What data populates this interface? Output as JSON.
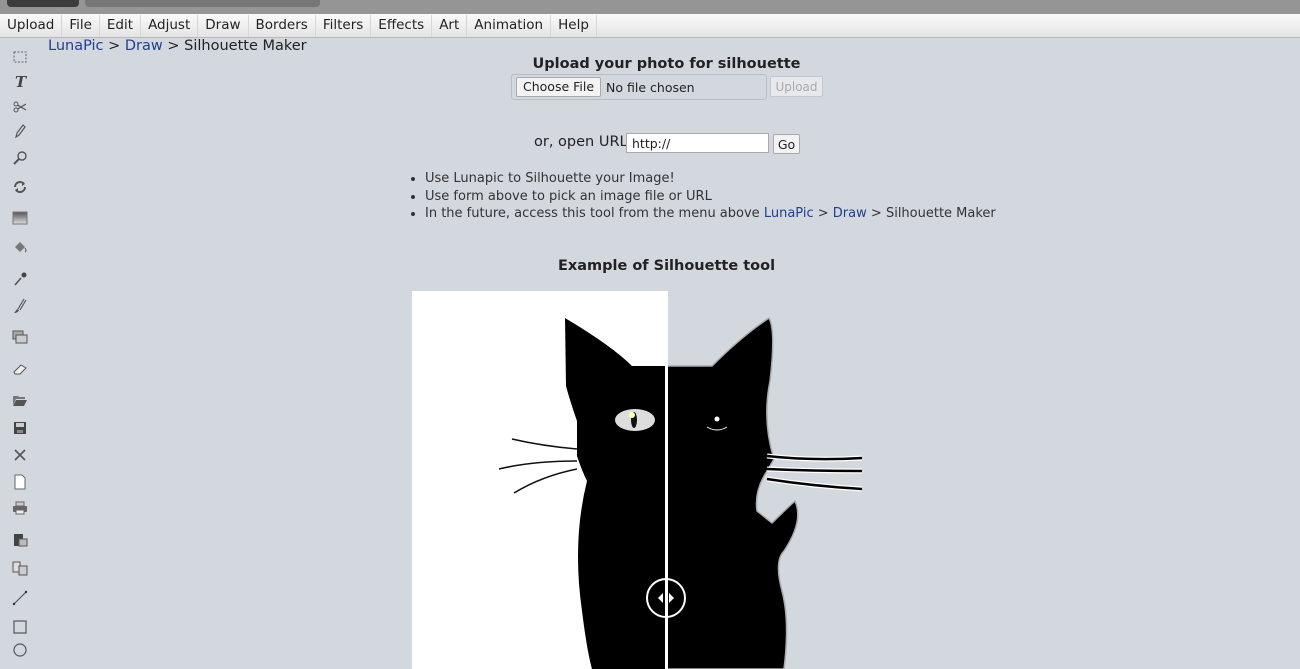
{
  "menu": {
    "items": [
      "Upload",
      "File",
      "Edit",
      "Adjust",
      "Draw",
      "Borders",
      "Filters",
      "Effects",
      "Art",
      "Animation",
      "Help"
    ]
  },
  "toolbar": {
    "tools": [
      "select-icon",
      "text-icon",
      "scissors-icon",
      "pencil-icon",
      "zoom-icon",
      "rotate-icon",
      "gradient-icon",
      "paint-bucket-icon",
      "eyedropper-icon",
      "brush-icon",
      "layers-icon",
      "eraser-icon",
      "open-folder-icon",
      "save-icon",
      "close-icon",
      "new-page-icon",
      "print-icon",
      "paste-icon",
      "copy-icon",
      "line-icon",
      "rectangle-icon",
      "circle-icon"
    ]
  },
  "breadcrumb": {
    "root": "LunaPic",
    "sep1": ">",
    "section": "Draw",
    "sep2": ">",
    "current": "Silhouette Maker"
  },
  "upload": {
    "title": "Upload your photo for silhouette",
    "choose_label": "Choose File",
    "file_status": "No file chosen",
    "upload_label": "Upload"
  },
  "url": {
    "label": "or, open URL",
    "value": "http://",
    "go_label": "Go"
  },
  "tips": {
    "item1": "Use Lunapic to Silhouette your Image!",
    "item2": "Use form above to pick an image file or URL",
    "item3_prefix": "In the future, access this tool from the menu above",
    "item3_link1": "LunaPic",
    "item3_sep1": ">",
    "item3_link2": "Draw",
    "item3_sep2": ">",
    "item3_suffix": "Silhouette Maker"
  },
  "example": {
    "title": "Example of Silhouette tool",
    "slider_position": 0.55
  }
}
